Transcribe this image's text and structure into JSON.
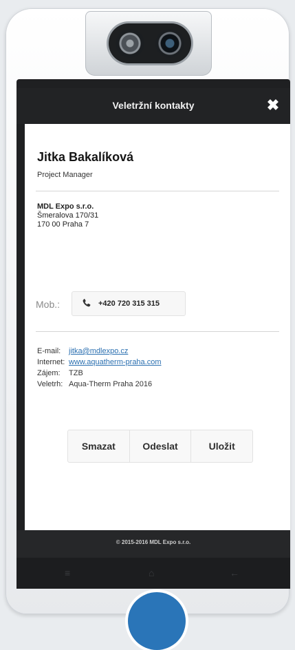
{
  "header": {
    "title": "Veletržní kontakty",
    "close_icon": "close-icon"
  },
  "contact": {
    "name": "Jitka Bakalíková",
    "role": "Project Manager",
    "company_name": "MDL Expo s.r.o.",
    "street": "Šmeralova 170/31",
    "city": "170 00 Praha 7"
  },
  "phone": {
    "label": "Mob.:",
    "number": "+420 720 315 315",
    "icon": "phone-icon"
  },
  "info": {
    "email_label": "E-mail:",
    "email": "jitka@mdlexpo.cz",
    "web_label": "Internet:",
    "web": "www.aquatherm-praha.com",
    "interest_label": "Zájem:",
    "interest": "TZB",
    "fair_label": "Veletrh:",
    "fair": "Aqua-Therm Praha 2016"
  },
  "actions": {
    "delete": "Smazat",
    "send": "Odeslat",
    "save": "Uložit"
  },
  "footer": {
    "text": "© 2015-2016 MDL Expo s.r.o."
  },
  "colors": {
    "link": "#2a6fb0",
    "header_bg": "#222325",
    "accent": "#2a75b8"
  }
}
